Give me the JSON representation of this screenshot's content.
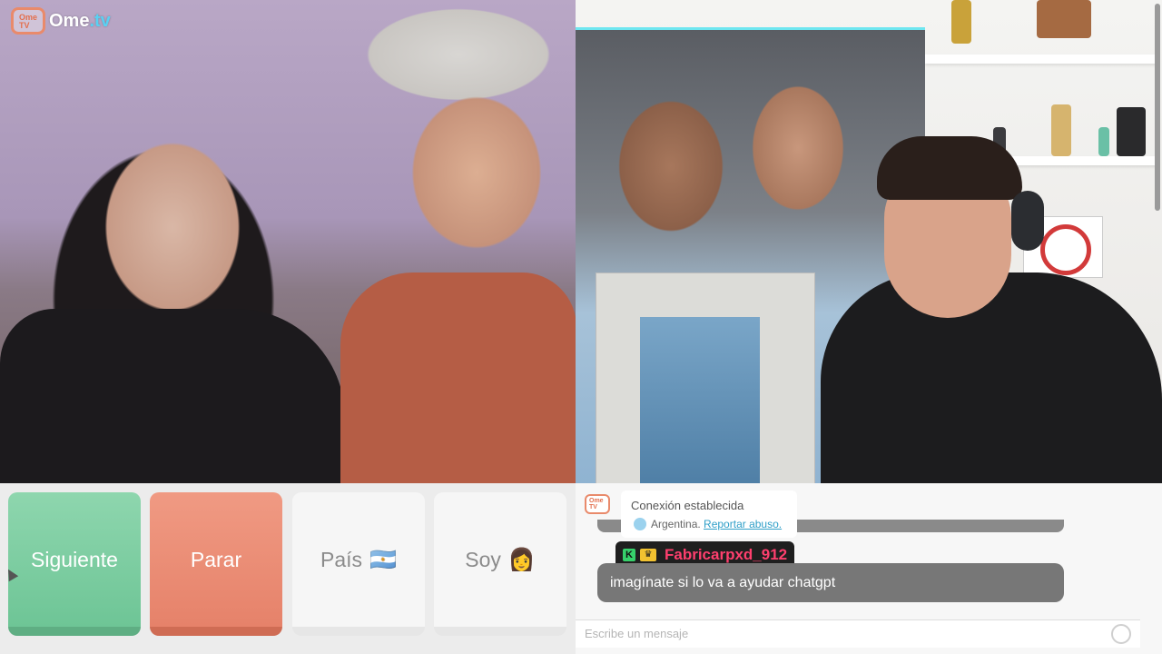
{
  "app": {
    "logo_text_main": "Ome",
    "logo_text_tld": ".tv",
    "logo_badge": "Ome TV"
  },
  "controls": {
    "next_label": "Siguiente",
    "stop_label": "Parar",
    "country_label": "País",
    "country_flag": "🇦🇷",
    "soy_label": "Soy",
    "soy_emoji": "👩"
  },
  "chat": {
    "system_title": "Conexión establecida",
    "system_country": "Argentina.",
    "report_link": "Reportar abuso.",
    "username": "Fabricarpxd_912",
    "badge_letter": "K",
    "message": "imagínate si lo va a ayudar chatgpt",
    "input_placeholder": "Escribe un mensaje"
  },
  "colors": {
    "next": "#7ccca0",
    "stop": "#ea8b73",
    "username": "#ff3f6e",
    "logo_accent": "#5ad0f2"
  }
}
